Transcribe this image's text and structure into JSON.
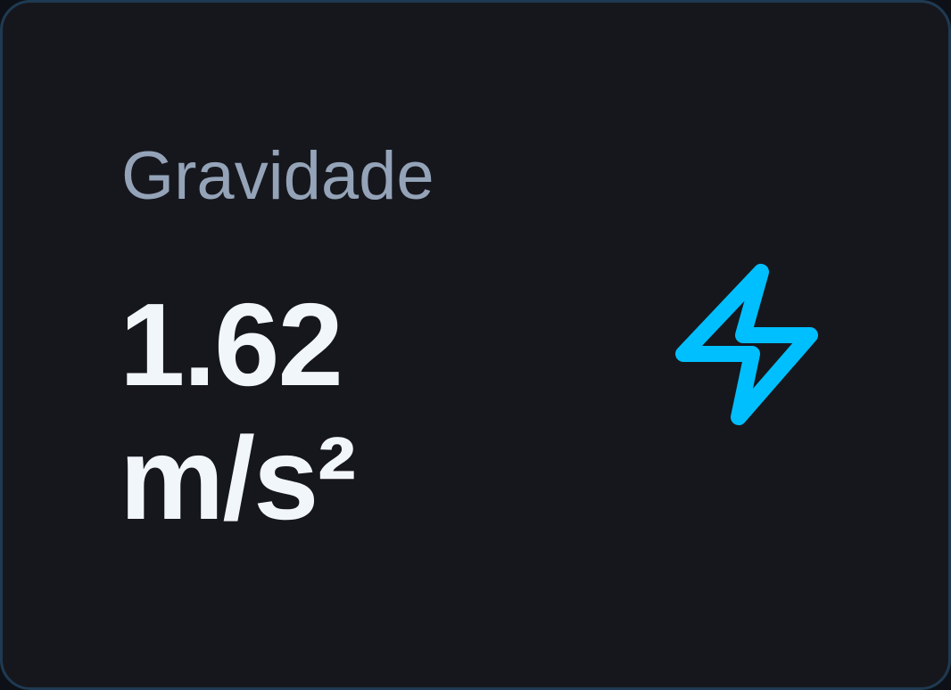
{
  "stat_card": {
    "label": "Gravidade",
    "value_number": "1.62",
    "value_unit": "m/s²",
    "icon": "lightning-bolt-icon",
    "accent_color": "#00bfff"
  }
}
